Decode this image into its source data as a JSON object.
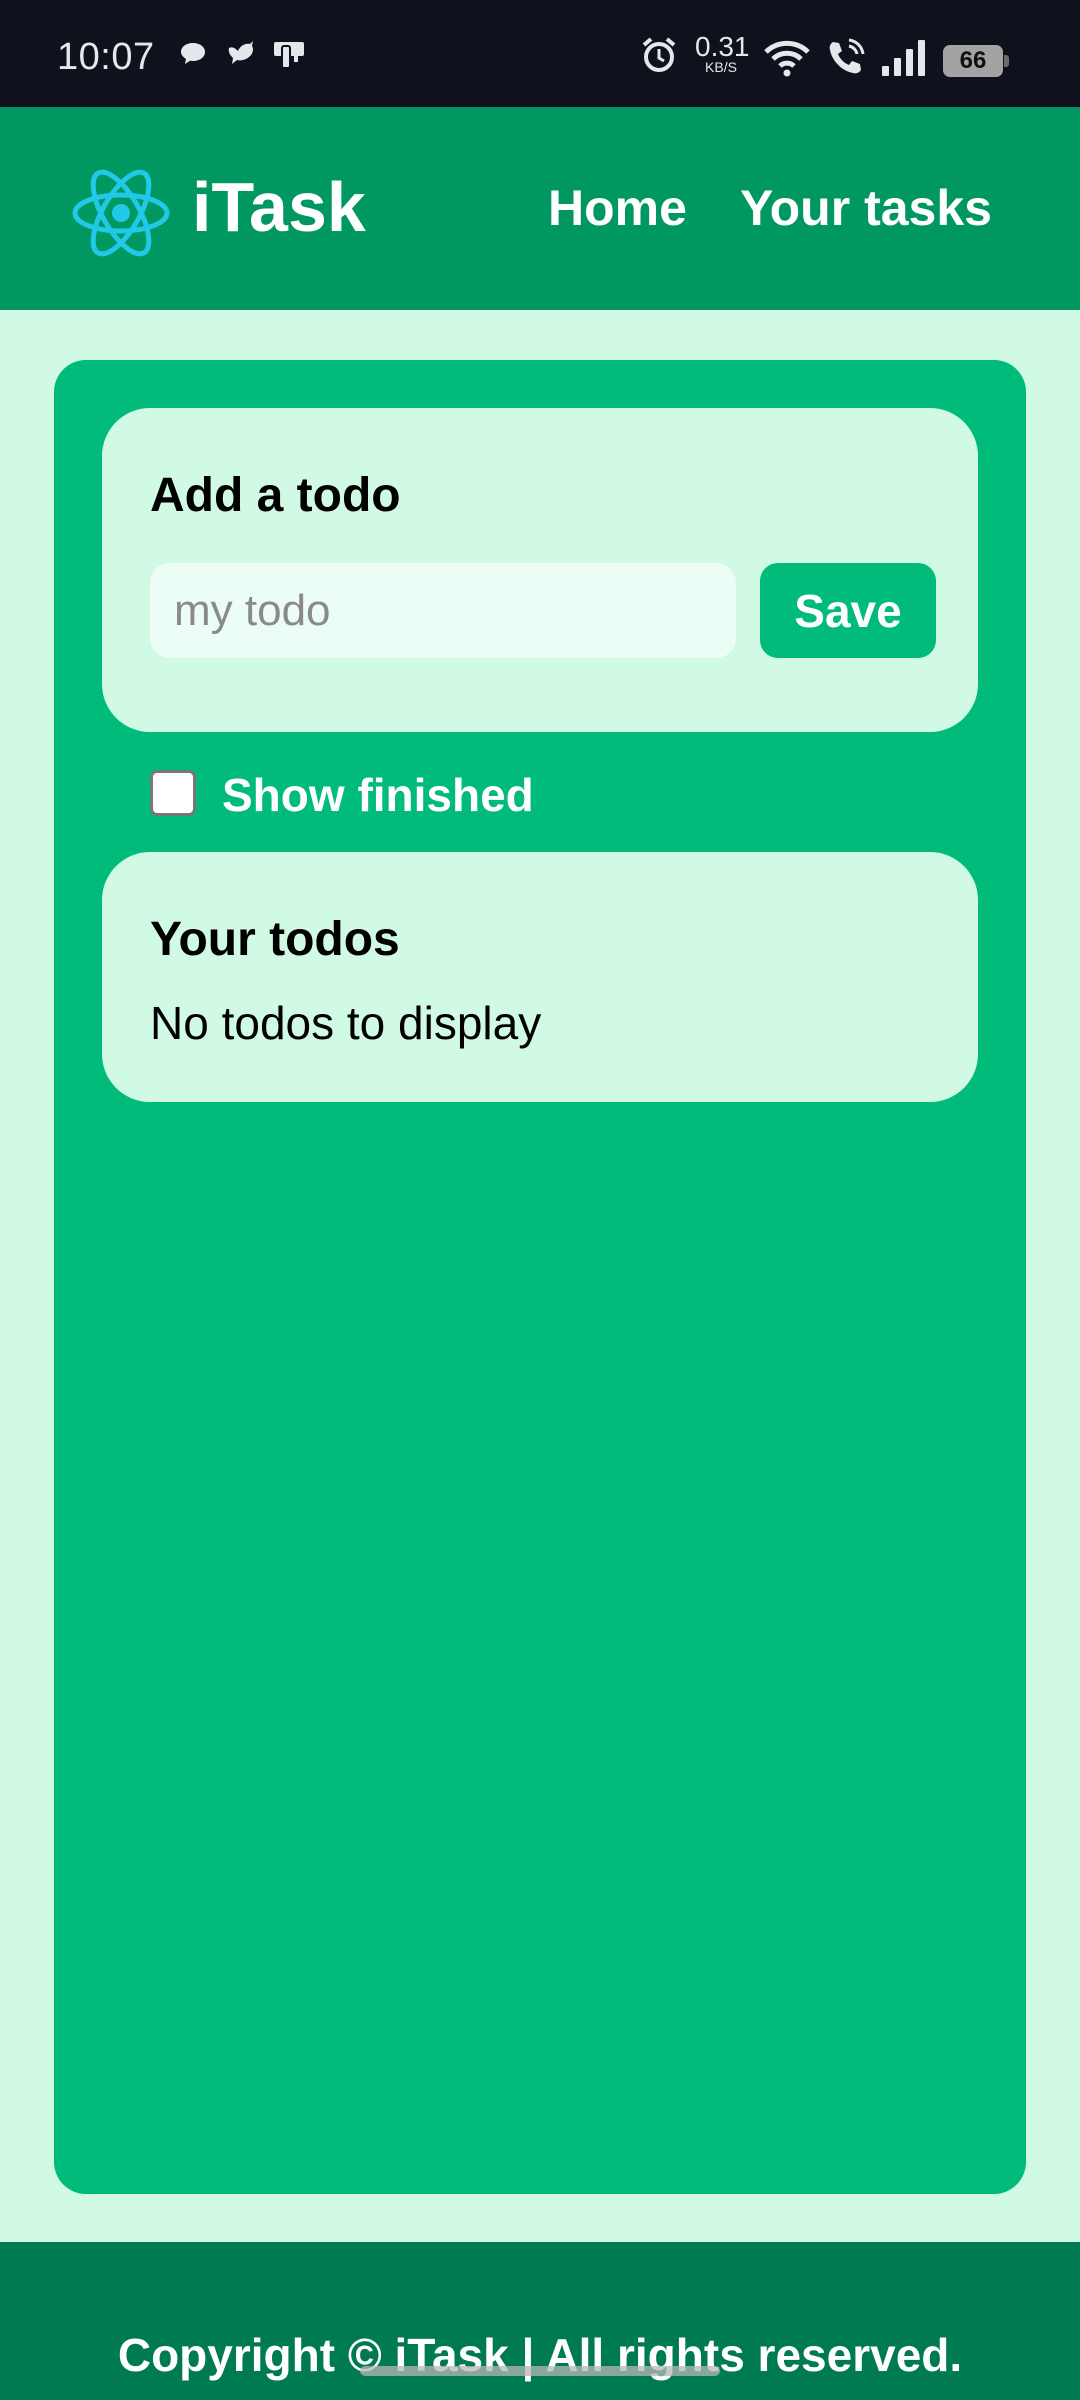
{
  "status_bar": {
    "time": "10:07",
    "net_speed_value": "0.31",
    "net_speed_unit": "KB/S",
    "battery": "66",
    "icons": [
      "chat-bubble-icon",
      "bird-icon",
      "device-icon",
      "alarm-icon",
      "wifi-icon",
      "wifi-call-icon",
      "signal-icon",
      "battery-icon"
    ]
  },
  "header": {
    "logo_icon": "atom-icon",
    "brand": "iTask",
    "nav": [
      {
        "label": "Home"
      },
      {
        "label": "Your tasks"
      }
    ]
  },
  "add_todo": {
    "title": "Add a todo",
    "input_placeholder": "my todo",
    "input_value": "",
    "save_label": "Save"
  },
  "filter": {
    "show_finished_label": "Show finished",
    "show_finished_checked": false
  },
  "todos": {
    "title": "Your todos",
    "empty_text": "No todos to display"
  },
  "footer": {
    "text": "Copyright © iTask | All rights reserved."
  },
  "colors": {
    "page_bg": "#d1fae5",
    "header_bg": "#009761",
    "main_bg": "#00bb7a",
    "card_bg": "#d1fae5",
    "footer_bg": "#007a52",
    "logo_accent": "#22c8e8"
  }
}
